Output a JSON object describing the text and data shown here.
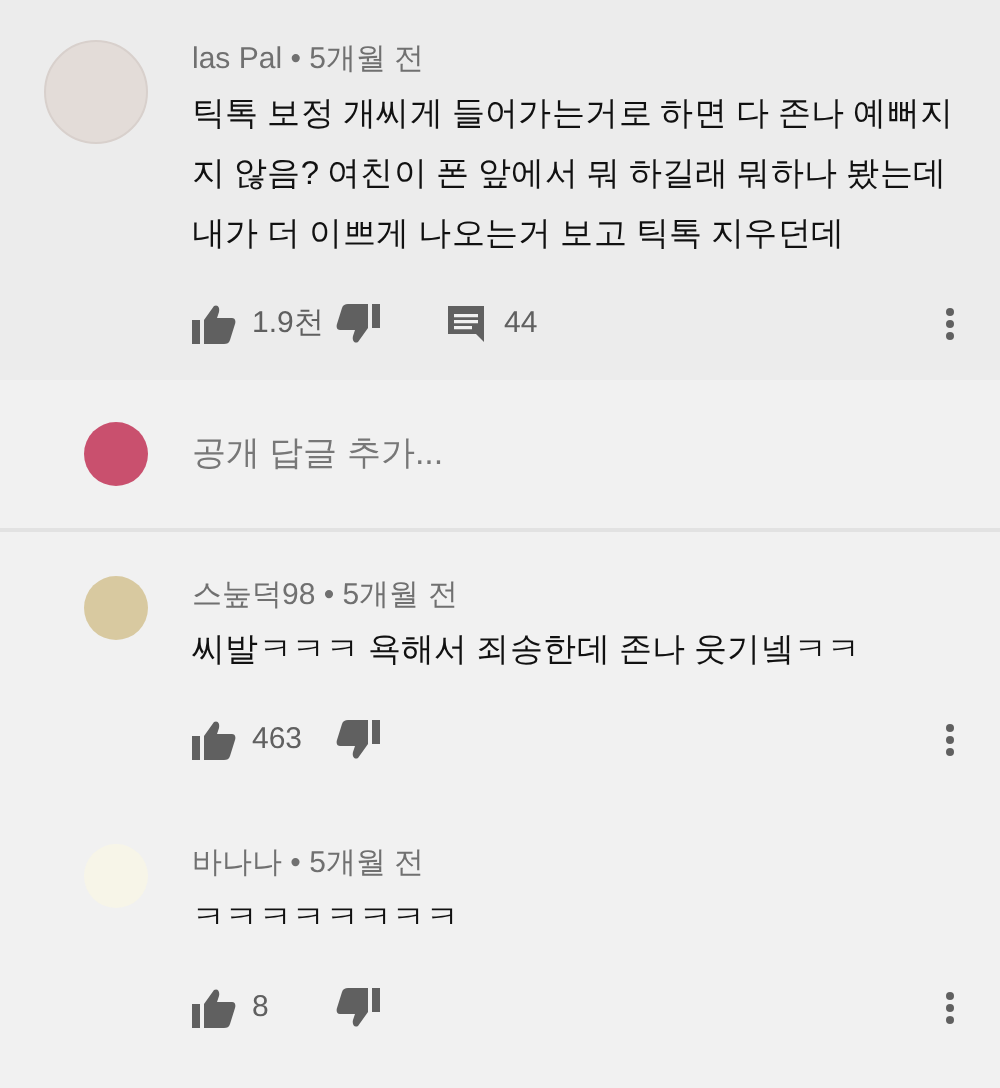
{
  "top_comment": {
    "meta": "las Pal • 5개월 전",
    "text": "틱톡 보정 개씨게 들어가는거로 하면 다 존나 예뻐지지 않음? 여친이 폰 앞에서 뭐 하길래 뭐하나 봤는데 내가 더 이쁘게 나오는거 보고 틱톡 지우던데",
    "likes": "1.9천",
    "replies": "44"
  },
  "reply_box": {
    "placeholder": "공개 답글 추가..."
  },
  "replies": [
    {
      "meta": "스눞덕98 • 5개월 전",
      "text": "씨발ㅋㅋㅋ 욕해서 죄송한데 존나 웃기넼ㅋㅋ",
      "likes": "463"
    },
    {
      "meta": "바나나 • 5개월 전",
      "text": "ㅋㅋㅋㅋㅋㅋㅋㅋ",
      "likes": "8"
    }
  ]
}
